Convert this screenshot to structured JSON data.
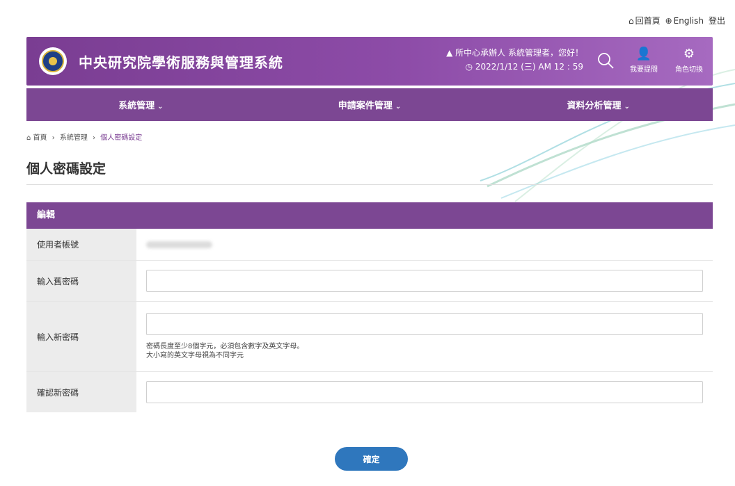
{
  "util": {
    "home": "回首頁",
    "lang": "English",
    "logout": "登出"
  },
  "header": {
    "title": "中央研究院學術服務與管理系統",
    "greeting": "所中心承辦人 系統管理者，您好！",
    "datetime": "2022/1/12 (三) AM 12 : 59",
    "ask_label": "我要提問",
    "role_label": "角色切換"
  },
  "nav": {
    "items": [
      {
        "label": "系統管理"
      },
      {
        "label": "申請案件管理"
      },
      {
        "label": "資料分析管理"
      }
    ]
  },
  "breadcrumb": {
    "items": [
      "首頁",
      "系統管理",
      "個人密碼設定"
    ]
  },
  "page": {
    "title": "個人密碼設定"
  },
  "form": {
    "section_title": "編輯",
    "rows": [
      {
        "label": "使用者帳號"
      },
      {
        "label": "輸入舊密碼"
      },
      {
        "label": "輸入新密碼"
      },
      {
        "label": "確認新密碼"
      }
    ],
    "hint_line1": "密碼長度至少8個字元，必須包含數字及英文字母。",
    "hint_line2": "大小寫的英文字母視為不同字元",
    "confirm_label": "確定"
  },
  "colors": {
    "primary_purple": "#7c4793",
    "button_blue": "#2f77bd"
  }
}
